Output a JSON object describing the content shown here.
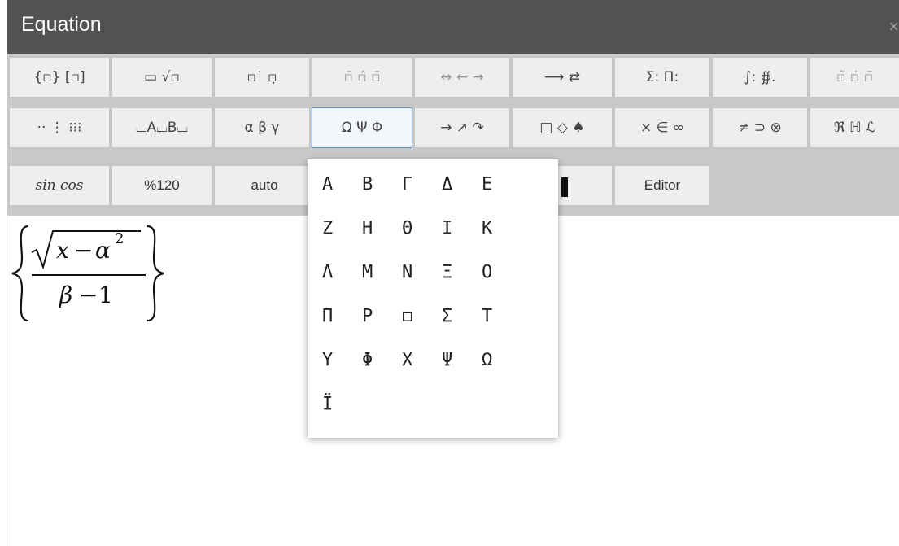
{
  "window": {
    "title": "Equation",
    "close_glyph": "×"
  },
  "toolbar": {
    "row1": [
      {
        "name": "brackets-group",
        "text": "{▫} [▫]"
      },
      {
        "name": "fraction-root-group",
        "text": "▭ √▫"
      },
      {
        "name": "script-group",
        "text": "▫˙ ▫̣"
      },
      {
        "name": "overline-group",
        "text": "▫̄ ▫̂ ▫̄"
      },
      {
        "name": "arrows-over-group",
        "text": "↔ ← →"
      },
      {
        "name": "long-arrows-group",
        "text": "⟶ ⇄"
      },
      {
        "name": "sum-product-group",
        "text": "Σ: Π:"
      },
      {
        "name": "integral-group",
        "text": "∫: ∯."
      },
      {
        "name": "accents-group",
        "text": "▫̃ ▫̇ ▫̄"
      }
    ],
    "row2": [
      {
        "name": "dots-group",
        "text": "·· ⋮ ⁝⁝⁝"
      },
      {
        "name": "subscript-group",
        "text": "⌴A⌴B⌴"
      },
      {
        "name": "greek-lower-group",
        "text": "α β γ"
      },
      {
        "name": "greek-upper-group",
        "text": "Ω Ψ Φ"
      },
      {
        "name": "arrows-group",
        "text": "→ ↗ ↷"
      },
      {
        "name": "shapes-group",
        "text": "□ ◇ ♠"
      },
      {
        "name": "operators-group",
        "text": "× ∈ ∞"
      },
      {
        "name": "relations-group",
        "text": "≠ ⊃ ⊗"
      },
      {
        "name": "fraktur-group",
        "text": "ℜ ℍ ℒ"
      }
    ],
    "row3": [
      {
        "name": "functions-button",
        "text": "sin cos"
      },
      {
        "name": "zoom-button",
        "text": "%120"
      },
      {
        "name": "auto-button",
        "text": "auto"
      },
      {
        "name": "editor-button",
        "text": "Editor"
      }
    ]
  },
  "formula": {
    "radicand_x": "x",
    "minus1": "−",
    "alpha": "α",
    "exponent": "2",
    "beta": "β",
    "minus2": "−",
    "one": "1"
  },
  "greek_popup": {
    "symbols": [
      "Α",
      "Β",
      "Γ",
      "Δ",
      "Ε",
      "Ζ",
      "Η",
      "Θ",
      "Ι",
      "Κ",
      "Λ",
      "Μ",
      "Ν",
      "Ξ",
      "Ο",
      "Π",
      "Ρ",
      "◻",
      "Σ",
      "Τ",
      "Υ",
      "Φ",
      "Χ",
      "Ψ",
      "Ω",
      "Ϊ"
    ]
  },
  "colors": {
    "titlebar": "#525252",
    "toolbar_bg": "#c8c8c8",
    "button_bg": "#eeeeee",
    "active_border": "#5c90c6"
  }
}
